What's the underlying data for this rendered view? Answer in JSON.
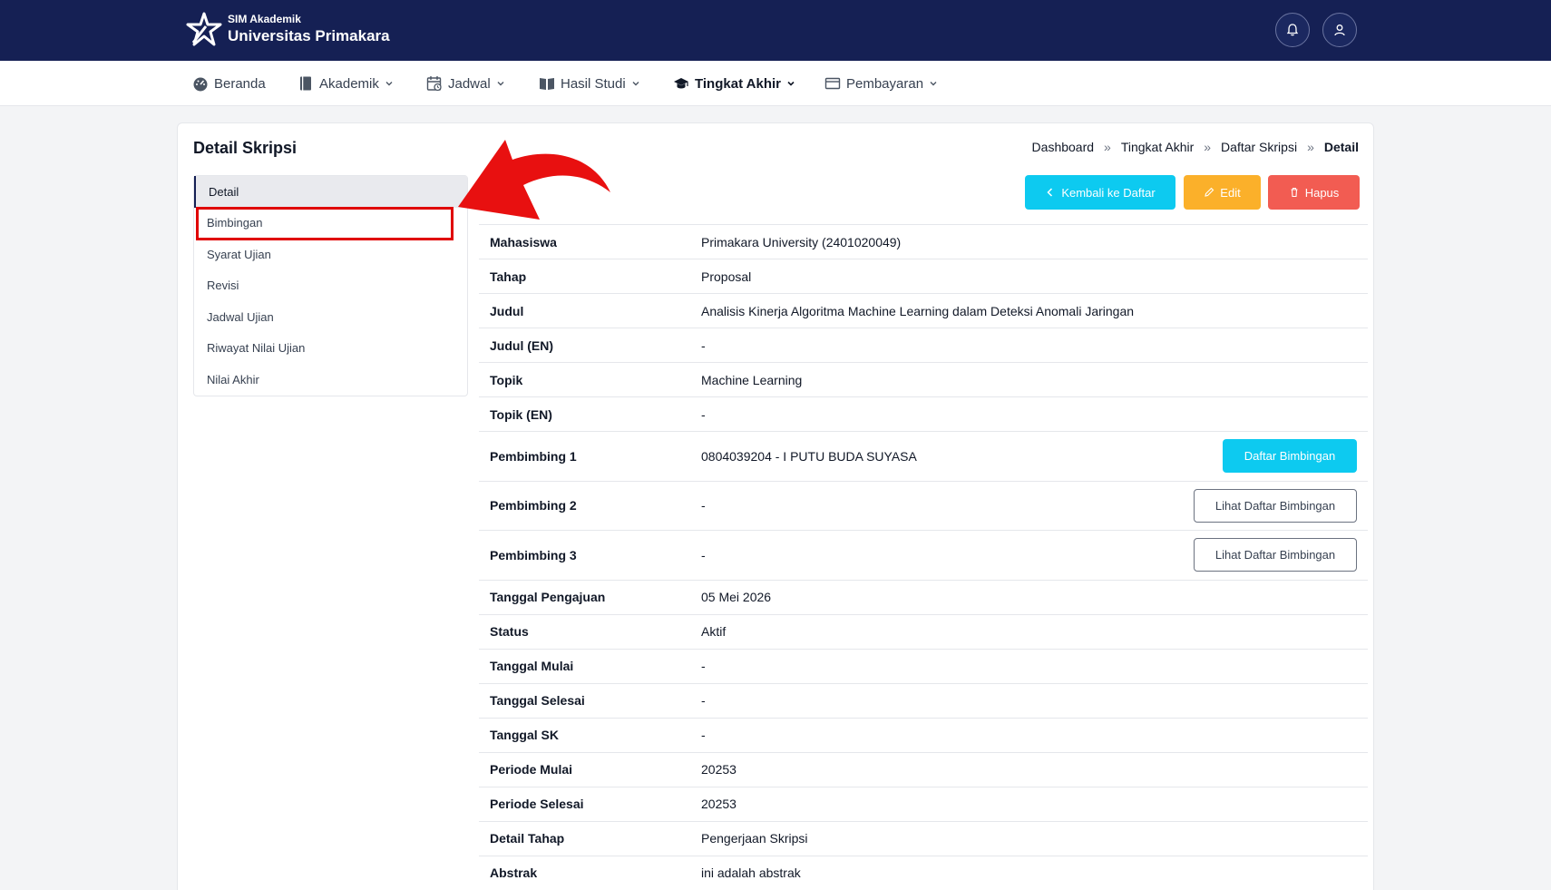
{
  "header": {
    "brand_small": "SIM Akademik",
    "brand_name": "Universitas Primakara",
    "icons": [
      "logo-star-icon",
      "bell-icon",
      "user-icon"
    ],
    "color": "#152054"
  },
  "nav": {
    "items": [
      {
        "label": "Beranda",
        "icon": "dashboard-icon"
      },
      {
        "label": "Akademik",
        "icon": "book-icon"
      },
      {
        "label": "Jadwal",
        "icon": "calendar-clock-icon"
      },
      {
        "label": "Hasil Studi",
        "icon": "open-book-icon"
      },
      {
        "label": "Tingkat Akhir",
        "icon": "graduation-cap-icon",
        "active": true
      },
      {
        "label": "Pembayaran",
        "icon": "wallet-icon"
      }
    ]
  },
  "page": {
    "title": "Detail Skripsi",
    "breadcrumb": [
      "Dashboard",
      "Tingkat Akhir",
      "Daftar Skripsi",
      "Detail"
    ],
    "breadcrumb_sep": "»"
  },
  "side_menu": {
    "items": [
      "Detail",
      "Bimbingan",
      "Syarat Ujian",
      "Revisi",
      "Jadwal Ujian",
      "Riwayat Nilai Ujian",
      "Nilai Akhir"
    ],
    "active": "Detail",
    "highlighted": "Bimbingan",
    "highlight_color": "#e00000"
  },
  "actions": {
    "back_label": "Kembali ke Daftar",
    "edit_label": "Edit",
    "delete_label": "Hapus",
    "colors": {
      "info": "#0dcaf0",
      "warning": "#fbb02a",
      "danger": "#f25c52"
    }
  },
  "detail": {
    "rows": [
      {
        "label": "Mahasiswa",
        "value": "Primakara University (2401020049)"
      },
      {
        "label": "Tahap",
        "value": "Proposal"
      },
      {
        "label": "Judul",
        "value": "Analisis Kinerja Algoritma Machine Learning dalam Deteksi Anomali Jaringan"
      },
      {
        "label": "Judul (EN)",
        "value": "-"
      },
      {
        "label": "Topik",
        "value": "Machine Learning"
      },
      {
        "label": "Topik (EN)",
        "value": "-"
      },
      {
        "label": "Pembimbing 1",
        "value": "0804039204 - I PUTU BUDA SUYASA",
        "button": "Daftar Bimbingan"
      },
      {
        "label": "Pembimbing 2",
        "value": "-",
        "button": "Lihat Daftar Bimbingan"
      },
      {
        "label": "Pembimbing 3",
        "value": "-",
        "button": "Lihat Daftar Bimbingan"
      },
      {
        "label": "Tanggal Pengajuan",
        "value": "05 Mei 2026"
      },
      {
        "label": "Status",
        "value": "Aktif"
      },
      {
        "label": "Tanggal Mulai",
        "value": "-"
      },
      {
        "label": "Tanggal Selesai",
        "value": "-"
      },
      {
        "label": "Tanggal SK",
        "value": "-"
      },
      {
        "label": "Periode Mulai",
        "value": "20253"
      },
      {
        "label": "Periode Selesai",
        "value": "20253"
      },
      {
        "label": "Detail Tahap",
        "value": "Pengerjaan Skripsi"
      },
      {
        "label": "Abstrak",
        "value": "ini adalah abstrak"
      }
    ]
  },
  "annotation": {
    "arrow_color": "#e81010",
    "arrow_icon": "red-curved-arrow-icon"
  }
}
